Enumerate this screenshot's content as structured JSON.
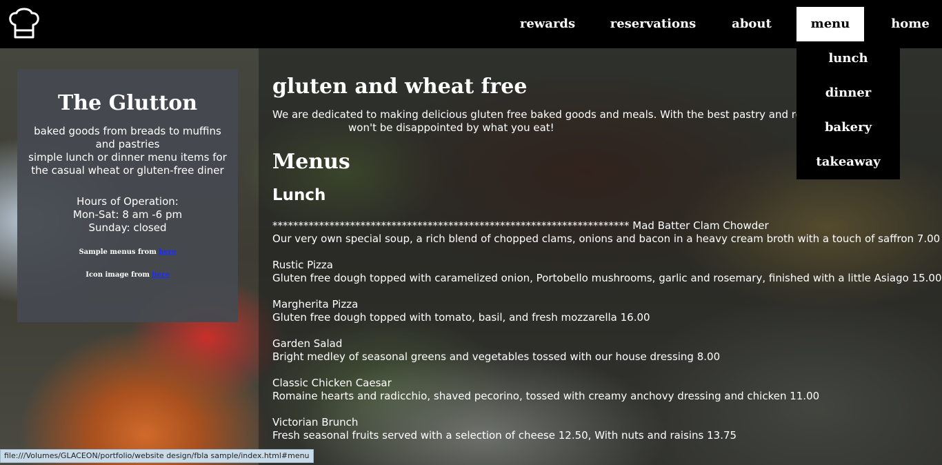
{
  "nav": {
    "items": [
      "rewards",
      "reservations",
      "about",
      "menu",
      "home"
    ],
    "active": "menu",
    "dropdown": [
      "lunch",
      "dinner",
      "bakery",
      "takeaway"
    ]
  },
  "sidebar": {
    "title": "The Glutton",
    "desc1": "baked goods from breads to muffins and pastries",
    "desc2": "simple lunch or dinner menu items for the casual wheat or gluten-free diner",
    "hours_title": "Hours of Operation:",
    "hours_weekday": "Mon-Sat: 8 am -6 pm",
    "hours_sunday": "Sunday: closed",
    "credit_menus_text": "Sample menus from",
    "credit_icon_text": "Icon image from",
    "link_label": "here"
  },
  "main": {
    "heading": "gluten and wheat free",
    "intro": "We are dedicated to making delicious gluten free baked goods and meals. With the best pastry and restaurant c",
    "intro_end": "won't be disappointed by what you eat!",
    "menus_heading": "Menus",
    "lunch_heading": "Lunch",
    "stars": "*********************************************************************",
    "items": [
      {
        "name": "Mad Batter Clam Chowder",
        "desc": "Our very own special soup, a rich blend of chopped clams, onions and bacon in a heavy cream broth with a touch of saffron 7.00"
      },
      {
        "name": "Rustic Pizza",
        "desc": "Gluten free dough topped with caramelized onion, Portobello mushrooms, garlic and rosemary, finished with a little Asiago 15.00"
      },
      {
        "name": "Margherita Pizza",
        "desc": "Gluten free dough topped with tomato, basil, and fresh mozzarella 16.00"
      },
      {
        "name": "Garden Salad",
        "desc": "Bright medley of seasonal greens and vegetables tossed with our house dressing 8.00"
      },
      {
        "name": "Classic Chicken Caesar",
        "desc": "Romaine hearts and radicchio, shaved pecorino, tossed with creamy anchovy dressing and chicken 11.00"
      },
      {
        "name": "Victorian Brunch",
        "desc": "Fresh seasonal fruits served with a selection of cheese 12.50, With nuts and raisins 13.75"
      }
    ]
  },
  "status_url": "file:///Volumes/GLACEON/portfolio/website design/fbla sample/index.html#menu",
  "colors": {
    "topbar": "#000000",
    "card": "#464a50",
    "link": "#1d2cff"
  },
  "icons": {
    "logo": "chef-hat-icon"
  }
}
